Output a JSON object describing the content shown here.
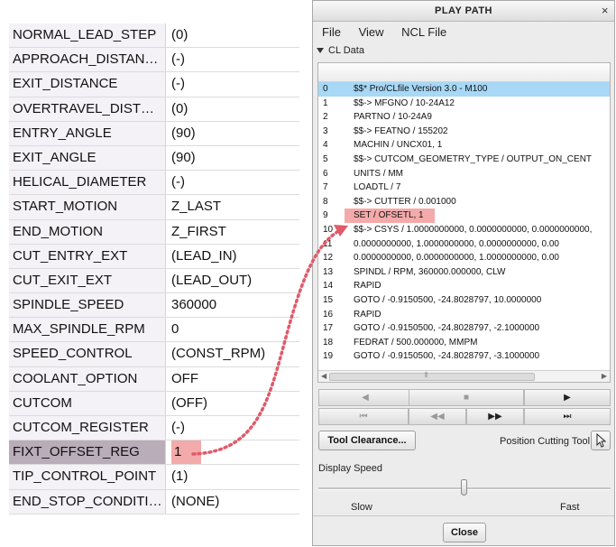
{
  "params": [
    {
      "name": "NORMAL_LEAD_STEP",
      "value": "(0)"
    },
    {
      "name": "APPROACH_DISTAN…",
      "value": "(-)"
    },
    {
      "name": "EXIT_DISTANCE",
      "value": "(-)"
    },
    {
      "name": "OVERTRAVEL_DIST…",
      "value": "(0)"
    },
    {
      "name": "ENTRY_ANGLE",
      "value": "(90)"
    },
    {
      "name": "EXIT_ANGLE",
      "value": "(90)"
    },
    {
      "name": "HELICAL_DIAMETER",
      "value": "(-)"
    },
    {
      "name": "START_MOTION",
      "value": "Z_LAST"
    },
    {
      "name": "END_MOTION",
      "value": "Z_FIRST"
    },
    {
      "name": "CUT_ENTRY_EXT",
      "value": "(LEAD_IN)"
    },
    {
      "name": "CUT_EXIT_EXT",
      "value": "(LEAD_OUT)"
    },
    {
      "name": "SPINDLE_SPEED",
      "value": "360000"
    },
    {
      "name": "MAX_SPINDLE_RPM",
      "value": "0"
    },
    {
      "name": "SPEED_CONTROL",
      "value": "(CONST_RPM)"
    },
    {
      "name": "COOLANT_OPTION",
      "value": "OFF"
    },
    {
      "name": "CUTCOM",
      "value": "(OFF)"
    },
    {
      "name": "CUTCOM_REGISTER",
      "value": "(-)"
    },
    {
      "name": "FIXT_OFFSET_REG",
      "value": "1"
    },
    {
      "name": "TIP_CONTROL_POINT",
      "value": "(1)"
    },
    {
      "name": "END_STOP_CONDITI…",
      "value": "(NONE)"
    }
  ],
  "highlighted_param_index": 17,
  "dialog": {
    "title": "PLAY PATH",
    "close_glyph": "×",
    "menu": [
      "File",
      "View",
      "NCL File"
    ],
    "section_label": "CL Data",
    "cl_lines": [
      {
        "n": "0",
        "text": "$$*              Pro/CLfile  Version 3.0 - M100"
      },
      {
        "n": "1",
        "text": "$$-> MFGNO / 10-24A12"
      },
      {
        "n": "2",
        "text": "PARTNO / 10-24A9"
      },
      {
        "n": "3",
        "text": "$$-> FEATNO / 155202"
      },
      {
        "n": "4",
        "text": "MACHIN / UNCX01, 1"
      },
      {
        "n": "5",
        "text": "$$-> CUTCOM_GEOMETRY_TYPE / OUTPUT_ON_CENT"
      },
      {
        "n": "6",
        "text": "UNITS / MM"
      },
      {
        "n": "7",
        "text": "LOADTL / 7"
      },
      {
        "n": "8",
        "text": "$$-> CUTTER / 0.001000"
      },
      {
        "n": "9",
        "text": "SET / OFSETL,  1"
      },
      {
        "n": "10",
        "text": "$$-> CSYS / 1.0000000000, 0.0000000000, 0.0000000000,"
      },
      {
        "n": "11",
        "text": "             0.0000000000, 1.0000000000, 0.0000000000, 0.00"
      },
      {
        "n": "12",
        "text": "             0.0000000000, 0.0000000000, 1.0000000000, 0.00"
      },
      {
        "n": "13",
        "text": "SPINDL / RPM, 360000.000000,  CLW"
      },
      {
        "n": "14",
        "text": "RAPID"
      },
      {
        "n": "15",
        "text": "GOTO / -0.9150500, -24.8028797, 10.0000000"
      },
      {
        "n": "16",
        "text": "RAPID"
      },
      {
        "n": "17",
        "text": "GOTO / -0.9150500, -24.8028797, -2.1000000"
      },
      {
        "n": "18",
        "text": "FEDRAT / 500.000000,  MMPM"
      },
      {
        "n": "19",
        "text": "GOTO / -0.9150500, -24.8028797, -3.1000000"
      }
    ],
    "selected_line_index": 0,
    "highlighted_line_index": 9,
    "scroll_glyphs": {
      "left": "◀",
      "right": "▶",
      "grip": "⦀"
    },
    "transport_row1": [
      "◀",
      "■",
      "▶"
    ],
    "transport_row2": [
      "⏮",
      "◀◀",
      "▶▶",
      "⏭"
    ],
    "tool_clearance_label": "Tool Clearance...",
    "position_cutting_tool_label": "Position Cutting Tool",
    "display_speed_label": "Display Speed",
    "slow_label": "Slow",
    "fast_label": "Fast",
    "speed_fraction": 0.5,
    "close_label": "Close"
  },
  "colors": {
    "selection_blue": "#a7d8f6",
    "highlight_red": "#f4aaaa",
    "arrow_red": "#e05a6a"
  }
}
